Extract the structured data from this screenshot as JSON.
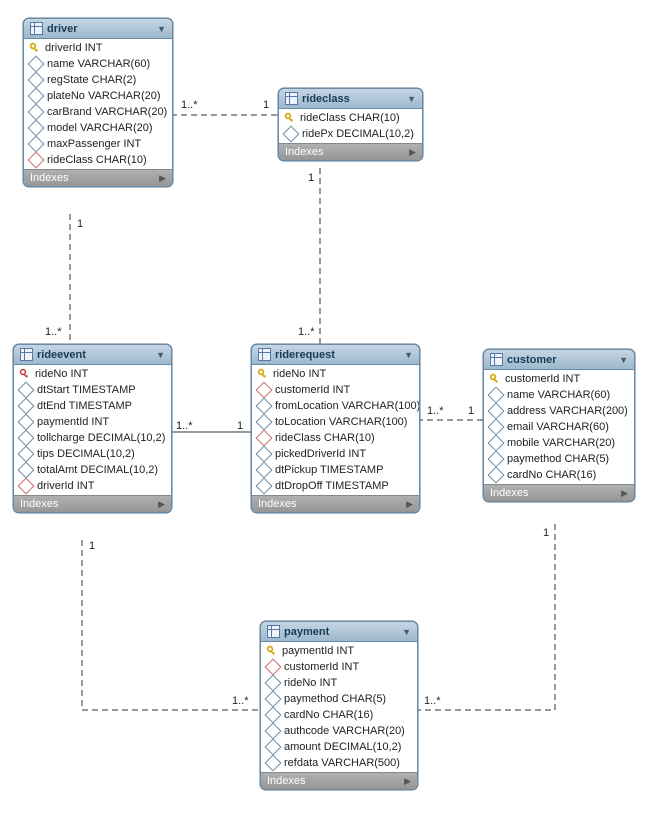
{
  "entities": {
    "driver": {
      "title": "driver",
      "footer": "Indexes",
      "columns": [
        {
          "icon": "pk",
          "text": "driverId INT"
        },
        {
          "icon": "attr",
          "text": "name VARCHAR(60)"
        },
        {
          "icon": "attr",
          "text": "regState CHAR(2)"
        },
        {
          "icon": "attr",
          "text": "plateNo VARCHAR(20)"
        },
        {
          "icon": "attr",
          "text": "carBrand VARCHAR(20)"
        },
        {
          "icon": "attr",
          "text": "model VARCHAR(20)"
        },
        {
          "icon": "attr",
          "text": "maxPassenger INT"
        },
        {
          "icon": "fk",
          "text": "rideClass CHAR(10)"
        }
      ]
    },
    "rideclass": {
      "title": "rideclass",
      "footer": "Indexes",
      "columns": [
        {
          "icon": "pk",
          "text": "rideClass CHAR(10)"
        },
        {
          "icon": "attr",
          "text": "ridePx DECIMAL(10,2)"
        }
      ]
    },
    "rideevent": {
      "title": "rideevent",
      "footer": "Indexes",
      "columns": [
        {
          "icon": "pkred",
          "text": "rideNo INT"
        },
        {
          "icon": "attr",
          "text": "dtStart TIMESTAMP"
        },
        {
          "icon": "attr",
          "text": "dtEnd TIMESTAMP"
        },
        {
          "icon": "attr",
          "text": "paymentId INT"
        },
        {
          "icon": "attr",
          "text": "tollcharge DECIMAL(10,2)"
        },
        {
          "icon": "attr",
          "text": "tips DECIMAL(10,2)"
        },
        {
          "icon": "attr",
          "text": "totalAmt DECIMAL(10,2)"
        },
        {
          "icon": "fk",
          "text": "driverId INT"
        }
      ]
    },
    "riderequest": {
      "title": "riderequest",
      "footer": "Indexes",
      "columns": [
        {
          "icon": "pk",
          "text": "rideNo INT"
        },
        {
          "icon": "fk",
          "text": "customerId INT"
        },
        {
          "icon": "attr",
          "text": "fromLocation VARCHAR(100)"
        },
        {
          "icon": "attr",
          "text": "toLocation VARCHAR(100)"
        },
        {
          "icon": "fk",
          "text": "rideClass CHAR(10)"
        },
        {
          "icon": "attr",
          "text": "pickedDriverId INT"
        },
        {
          "icon": "attr",
          "text": "dtPickup TIMESTAMP"
        },
        {
          "icon": "attr",
          "text": "dtDropOff TIMESTAMP"
        }
      ]
    },
    "customer": {
      "title": "customer",
      "footer": "Indexes",
      "columns": [
        {
          "icon": "pk",
          "text": "customerId INT"
        },
        {
          "icon": "attr",
          "text": "name VARCHAR(60)"
        },
        {
          "icon": "attr",
          "text": "address VARCHAR(200)"
        },
        {
          "icon": "attr",
          "text": "email VARCHAR(60)"
        },
        {
          "icon": "attr",
          "text": "mobile VARCHAR(20)"
        },
        {
          "icon": "attr",
          "text": "paymethod CHAR(5)"
        },
        {
          "icon": "attr",
          "text": "cardNo CHAR(16)"
        }
      ]
    },
    "payment": {
      "title": "payment",
      "footer": "Indexes",
      "columns": [
        {
          "icon": "pk",
          "text": "paymentId INT"
        },
        {
          "icon": "fk",
          "text": "customerId INT"
        },
        {
          "icon": "attr",
          "text": "rideNo INT"
        },
        {
          "icon": "attr",
          "text": "paymethod CHAR(5)"
        },
        {
          "icon": "attr",
          "text": "cardNo CHAR(16)"
        },
        {
          "icon": "attr",
          "text": "authcode VARCHAR(20)"
        },
        {
          "icon": "attr",
          "text": "amount DECIMAL(10,2)"
        },
        {
          "icon": "attr",
          "text": "refdata VARCHAR(500)"
        }
      ]
    }
  },
  "cardinalities": {
    "driver_rideclass_left": "1..*",
    "driver_rideclass_right": "1",
    "driver_rideevent_top": "1",
    "driver_rideevent_bottom": "1..*",
    "rideclass_riderequest_top": "1",
    "rideclass_riderequest_bottom": "1..*",
    "rideevent_riderequest_left": "1..*",
    "rideevent_riderequest_right": "1",
    "riderequest_customer_left": "1..*",
    "riderequest_customer_right": "1",
    "payment_customer_right": "1",
    "payment_customer_left": "1..*",
    "rideevent_payment_top": "1",
    "rideevent_payment_bottom": "1..*"
  }
}
